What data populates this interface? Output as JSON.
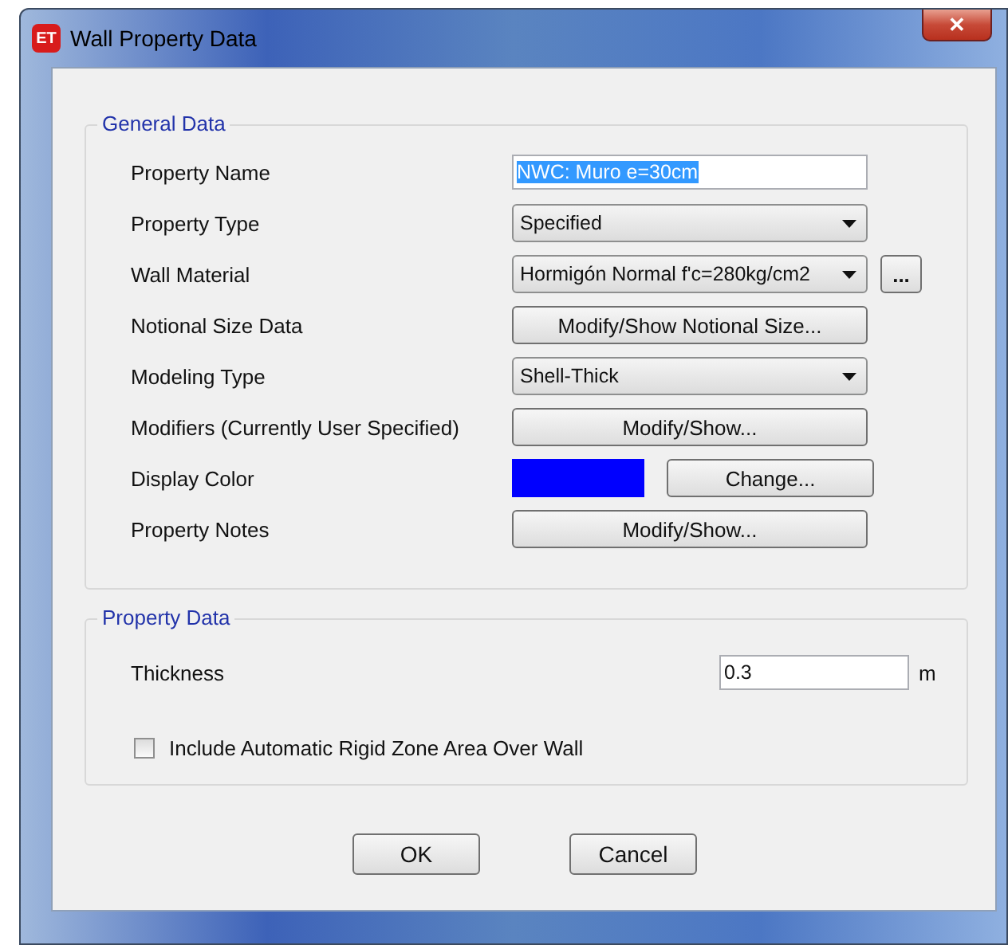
{
  "window": {
    "title": "Wall Property Data",
    "app_badge": "ET",
    "close": "✕"
  },
  "general_data": {
    "title": "General Data",
    "rows": [
      {
        "label": "Property Name",
        "kind": "text",
        "value": "NWC: Muro e=30cm",
        "highlighted": true
      },
      {
        "label": "Property Type",
        "kind": "dropdown",
        "value": "Specified"
      },
      {
        "label": "Wall Material",
        "kind": "dropdown_more",
        "value": "Hormigón Normal f'c=280kg/cm2",
        "more": "..."
      },
      {
        "label": "Notional Size Data",
        "kind": "button",
        "value": "Modify/Show Notional Size..."
      },
      {
        "label": "Modeling Type",
        "kind": "dropdown",
        "value": "Shell-Thick"
      },
      {
        "label": "Modifiers (Currently User Specified)",
        "kind": "button",
        "value": "Modify/Show..."
      },
      {
        "label": "Display Color",
        "kind": "color",
        "color": "#0000ff",
        "value": "Change..."
      },
      {
        "label": "Property Notes",
        "kind": "button",
        "value": "Modify/Show..."
      }
    ]
  },
  "property_data": {
    "title": "Property Data",
    "thickness": {
      "label": "Thickness",
      "value": "0.3",
      "unit": "m"
    },
    "rigid_zone": {
      "label": "Include Automatic Rigid Zone Area Over Wall",
      "checked": false
    }
  },
  "buttons": [
    "OK",
    "Cancel"
  ]
}
